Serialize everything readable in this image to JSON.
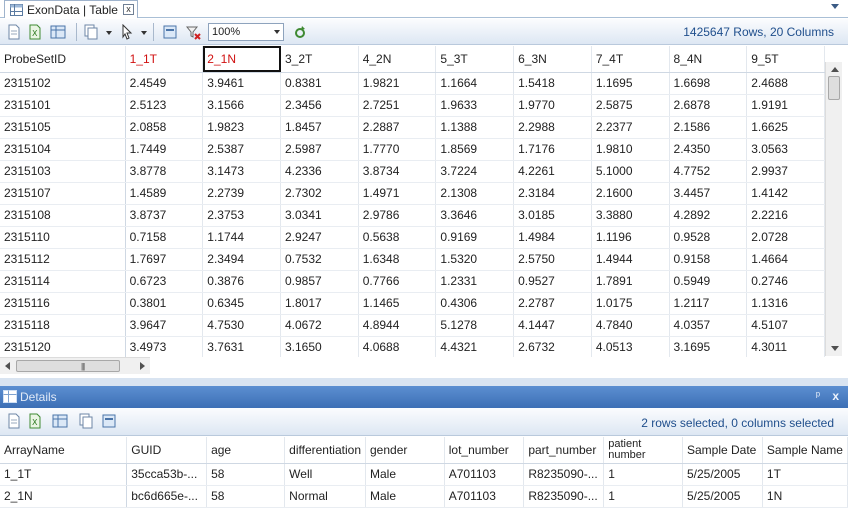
{
  "tab": {
    "title": "ExonData | Table",
    "close_glyph": "x"
  },
  "toolbar": {
    "zoom": "100%",
    "status": "1425647 Rows, 20 Columns"
  },
  "main_grid": {
    "columns": [
      "ProbeSetID",
      "1_1T",
      "2_1N",
      "3_2T",
      "4_2N",
      "5_3T",
      "6_3N",
      "7_4T",
      "8_4N",
      "9_5T"
    ],
    "rows": [
      [
        "2315102",
        "2.4549",
        "3.9461",
        "0.8381",
        "1.9821",
        "1.1664",
        "1.5418",
        "1.1695",
        "1.6698",
        "2.4688"
      ],
      [
        "2315101",
        "2.5123",
        "3.1566",
        "2.3456",
        "2.7251",
        "1.9633",
        "1.9770",
        "2.5875",
        "2.6878",
        "1.9191"
      ],
      [
        "2315105",
        "2.0858",
        "1.9823",
        "1.8457",
        "2.2887",
        "1.1388",
        "2.2988",
        "2.2377",
        "2.1586",
        "1.6625"
      ],
      [
        "2315104",
        "1.7449",
        "2.5387",
        "2.5987",
        "1.7770",
        "1.8569",
        "1.7176",
        "1.9810",
        "2.4350",
        "3.0563"
      ],
      [
        "2315103",
        "3.8778",
        "3.1473",
        "4.2336",
        "3.8734",
        "3.7224",
        "4.2261",
        "5.1000",
        "4.7752",
        "2.9937"
      ],
      [
        "2315107",
        "1.4589",
        "2.2739",
        "2.7302",
        "1.4971",
        "2.1308",
        "2.3184",
        "2.1600",
        "3.4457",
        "1.4142"
      ],
      [
        "2315108",
        "3.8737",
        "2.3753",
        "3.0341",
        "2.9786",
        "3.3646",
        "3.0185",
        "3.3880",
        "4.2892",
        "2.2216"
      ],
      [
        "2315110",
        "0.7158",
        "1.1744",
        "2.9247",
        "0.5638",
        "0.9169",
        "1.4984",
        "1.1196",
        "0.9528",
        "2.0728"
      ],
      [
        "2315112",
        "1.7697",
        "2.3494",
        "0.7532",
        "1.6348",
        "1.5320",
        "2.5750",
        "1.4944",
        "0.9158",
        "1.4664"
      ],
      [
        "2315114",
        "0.6723",
        "0.3876",
        "0.9857",
        "0.7766",
        "1.2331",
        "0.9527",
        "1.7891",
        "0.5949",
        "0.2746"
      ],
      [
        "2315116",
        "0.3801",
        "0.6345",
        "1.8017",
        "1.1465",
        "0.4306",
        "2.2787",
        "1.0175",
        "1.2117",
        "1.1316"
      ],
      [
        "2315118",
        "3.9647",
        "4.7530",
        "4.0672",
        "4.8944",
        "5.1278",
        "4.1447",
        "4.7840",
        "4.0357",
        "4.5107"
      ],
      [
        "2315120",
        "3.4973",
        "3.7631",
        "3.1650",
        "4.0688",
        "4.4321",
        "2.6732",
        "4.0513",
        "3.1695",
        "4.3011"
      ]
    ]
  },
  "details": {
    "title": "Details",
    "pin_glyph": "ᵖ",
    "close_glyph": "x",
    "status": "2 rows selected, 0 columns selected",
    "columns": [
      "ArrayName",
      "GUID",
      "age",
      "differentiation",
      "gender",
      "lot_number",
      "part_number",
      "patient number",
      "Sample Date",
      "Sample Name"
    ],
    "rows": [
      [
        "1_1T",
        "35cca53b-...",
        "58",
        "Well",
        "Male",
        "A701103",
        "R8235090-...",
        "1",
        "5/25/2005",
        "1T"
      ],
      [
        "2_1N",
        "bc6d665e-...",
        "58",
        "Normal",
        "Male",
        "A701103",
        "R8235090-...",
        "1",
        "5/25/2005",
        "1N"
      ]
    ]
  },
  "colors": {
    "accent": "#1f4e8c",
    "selected_header": "#d01010",
    "panel_title": "#4a7cc2"
  }
}
